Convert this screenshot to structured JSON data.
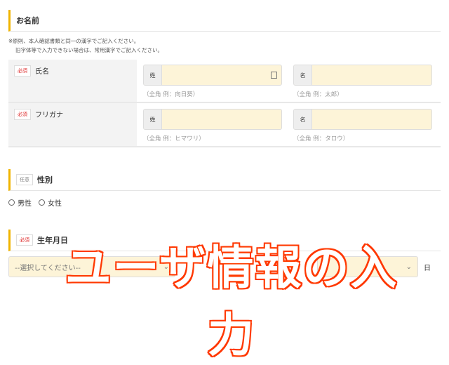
{
  "name_section": {
    "title": "お名前",
    "note1": "※原則、本人確認書類と同一の漢字でご記入ください。",
    "note2": "旧字体等で入力できない場合は、常用漢字でご記入ください。",
    "rows": [
      {
        "badge": "必須",
        "label": "氏名",
        "last_prefix": "姓",
        "last_hint": "（全角 例：向日葵）",
        "first_prefix": "名",
        "first_hint": "（全角 例：太郎）"
      },
      {
        "badge": "必須",
        "label": "フリガナ",
        "last_prefix": "姓",
        "last_hint": "（全角 例：ヒマワリ）",
        "first_prefix": "名",
        "first_hint": "（全角 例：タロウ）"
      }
    ]
  },
  "gender_section": {
    "badge": "任意",
    "title": "性別",
    "options": [
      "男性",
      "女性"
    ]
  },
  "birth_section": {
    "badge": "必須",
    "title": "生年月日",
    "year_placeholder": "--選択してください--",
    "day_suffix": "日"
  },
  "overlay": {
    "caption": "ユーザ情報の入力"
  }
}
